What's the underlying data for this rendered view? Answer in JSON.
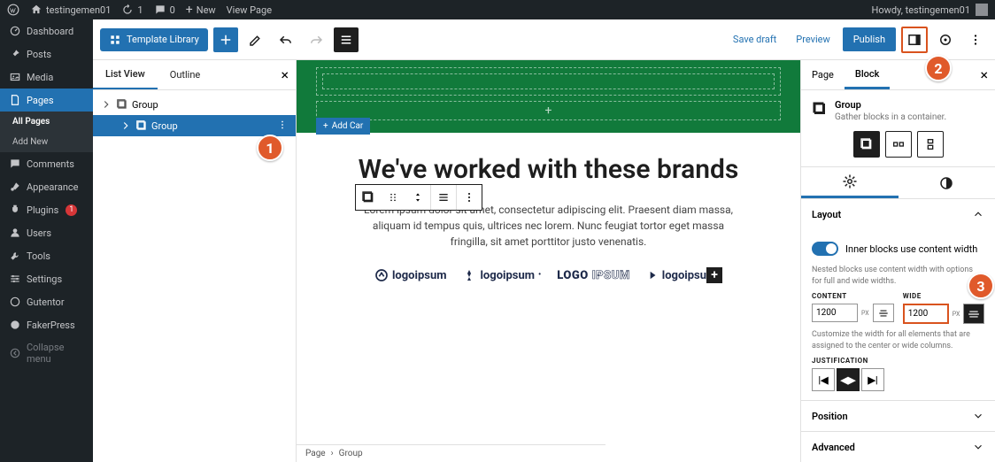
{
  "adminbar": {
    "site_name": "testingemen01",
    "updates": "1",
    "comments": "0",
    "new_label": "New",
    "view_page": "View Page",
    "howdy": "Howdy, testingemen01"
  },
  "sidebar": {
    "items": [
      {
        "label": "Dashboard"
      },
      {
        "label": "Posts"
      },
      {
        "label": "Media"
      },
      {
        "label": "Pages"
      },
      {
        "label": "Comments"
      },
      {
        "label": "Appearance"
      },
      {
        "label": "Plugins",
        "badge": "1"
      },
      {
        "label": "Users"
      },
      {
        "label": "Tools"
      },
      {
        "label": "Settings"
      },
      {
        "label": "Gutentor"
      },
      {
        "label": "FakerPress"
      },
      {
        "label": "Collapse menu"
      }
    ],
    "pages_sub": [
      {
        "label": "All Pages"
      },
      {
        "label": "Add New"
      }
    ]
  },
  "toolbar": {
    "template_library": "Template Library",
    "save_draft": "Save draft",
    "preview": "Preview",
    "publish": "Publish"
  },
  "listview": {
    "tab_list": "List View",
    "tab_outline": "Outline",
    "rows": [
      {
        "label": "Group"
      },
      {
        "label": "Group"
      }
    ]
  },
  "canvas": {
    "add_card": "Add Car",
    "heading": "We've worked with these brands",
    "paragraph": "Lorem ipsum dolor sit amet, consectetur adipiscing elit. Praesent diam massa, aliquam id tempus quis, ultrices nec lorem. Nunc feugiat tortor eget massa fringilla, sit amet porttitor justo venenatis.",
    "logos": [
      "logoipsum",
      "logoipsum",
      "LOGOIPSUM",
      "logoipsu"
    ]
  },
  "breadcrumb": {
    "items": [
      "Page",
      "Group"
    ]
  },
  "settings": {
    "tab_page": "Page",
    "tab_block": "Block",
    "block_name": "Group",
    "block_desc": "Gather blocks in a container.",
    "layout_title": "Layout",
    "toggle_label": "Inner blocks use content width",
    "toggle_help": "Nested blocks use content width with options for full and wide widths.",
    "content_label": "CONTENT",
    "wide_label": "WIDE",
    "content_value": "1200",
    "wide_value": "1200",
    "unit": "PX",
    "width_help": "Customize the width for all elements that are assigned to the center or wide columns.",
    "justification_label": "JUSTIFICATION",
    "position_title": "Position",
    "advanced_title": "Advanced"
  },
  "callouts": {
    "c1": "1",
    "c2": "2",
    "c3": "3"
  }
}
